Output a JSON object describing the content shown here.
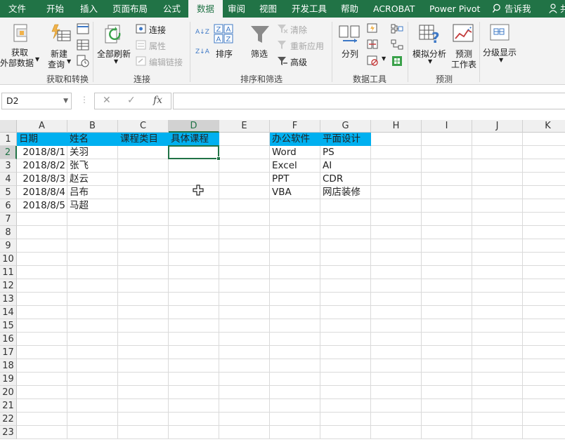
{
  "tabs": [
    "文件",
    "开始",
    "插入",
    "页面布局",
    "公式",
    "数据",
    "审阅",
    "视图",
    "开发工具",
    "帮助",
    "ACROBAT",
    "Power Pivot"
  ],
  "active_tab": "数据",
  "tell_me": "告诉我",
  "user_initial": "共",
  "ribbon": {
    "get_external": [
      "获取",
      "外部数据"
    ],
    "new_query": [
      "新建",
      "查询"
    ],
    "refresh_all": "全部刷新",
    "connections": "连接",
    "properties": "属性",
    "edit_links": "编辑链接",
    "sort": "排序",
    "filter": "筛选",
    "clear": "清除",
    "reapply": "重新应用",
    "advanced": "高级",
    "text_to_columns": "分列",
    "what_if": "模拟分析",
    "forecast_sheet": [
      "预测",
      "工作表"
    ],
    "outline": "分级显示",
    "sort_az": "A↓Z",
    "sort_za": "Z↓A",
    "groups": {
      "get_transform": "获取和转换",
      "connections": "连接",
      "sort_filter": "排序和筛选",
      "data_tools": "数据工具",
      "forecast": "预测"
    }
  },
  "formula_bar": {
    "name_box": "D2",
    "cancel": "✕",
    "enter": "✓",
    "fx": "fx",
    "value": ""
  },
  "columns": [
    "A",
    "B",
    "C",
    "D",
    "E",
    "F",
    "G",
    "H",
    "I",
    "J",
    "K"
  ],
  "selected_column": "D",
  "selected_row": 2,
  "rows": [
    "1",
    "2",
    "3",
    "4",
    "5",
    "6",
    "7",
    "8",
    "9",
    "10",
    "11",
    "12",
    "13",
    "14",
    "15",
    "16",
    "17",
    "18",
    "19",
    "20",
    "21",
    "22",
    "23"
  ],
  "table": {
    "headers": [
      "日期",
      "姓名",
      "课程类目",
      "具体课程"
    ],
    "rows": [
      [
        "2018/8/1",
        "关羽"
      ],
      [
        "2018/8/2",
        "张飞"
      ],
      [
        "2018/8/3",
        "赵云"
      ],
      [
        "2018/8/4",
        "吕布"
      ],
      [
        "2018/8/5",
        "马超"
      ]
    ]
  },
  "lookup": {
    "headers": [
      "办公软件",
      "平面设计"
    ],
    "rows": [
      [
        "Word",
        "PS"
      ],
      [
        "Excel",
        "AI"
      ],
      [
        "PPT",
        "CDR"
      ],
      [
        "VBA",
        "网店装修"
      ]
    ]
  },
  "colors": {
    "accent": "#217346",
    "header_fill": "#00b0f0"
  }
}
